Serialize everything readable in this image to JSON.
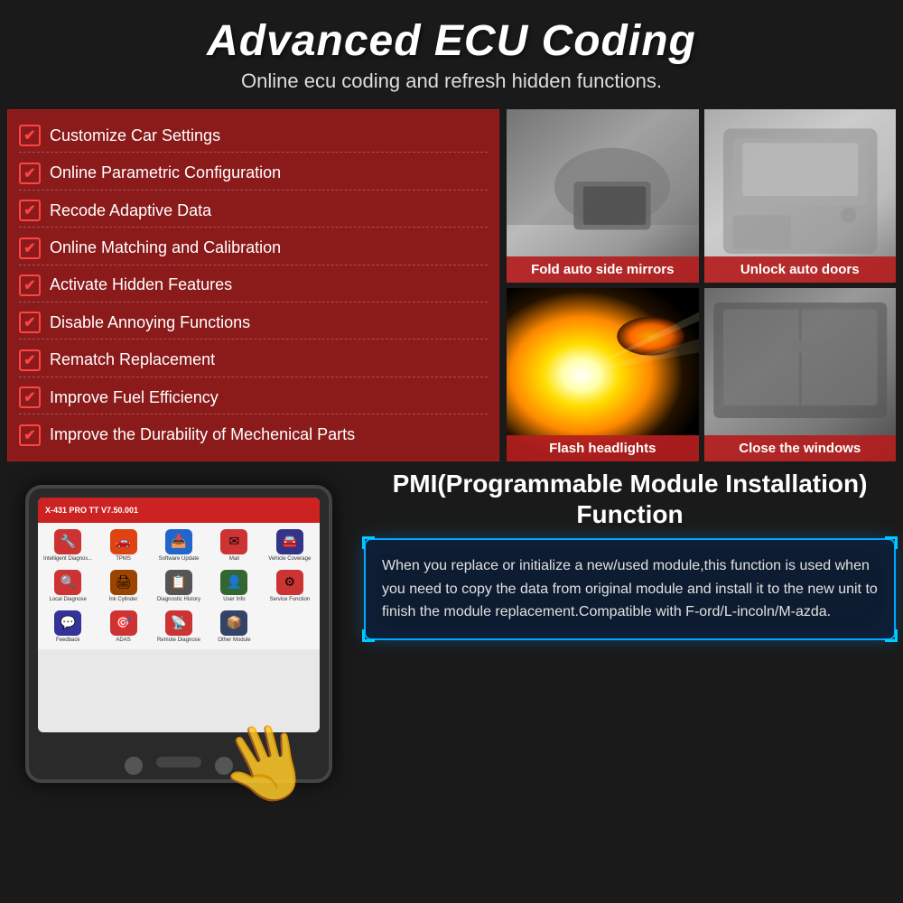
{
  "header": {
    "title": "Advanced ECU Coding",
    "subtitle": "Online ecu coding and refresh hidden functions."
  },
  "features": {
    "items": [
      "Customize Car Settings",
      "Online Parametric Configuration",
      "Recode Adaptive Data",
      "Online Matching and Calibration",
      "Activate Hidden Features",
      "Disable Annoying Functions",
      "Rematch Replacement",
      "Improve Fuel Efficiency",
      "Improve the Durability of Mechenical Parts"
    ]
  },
  "photos": [
    {
      "label": "Fold auto side mirrors",
      "type": "mirror"
    },
    {
      "label": "Unlock auto doors",
      "type": "door"
    },
    {
      "label": "Flash headlights",
      "type": "headlight"
    },
    {
      "label": "Close the windows",
      "type": "window"
    }
  ],
  "pmi": {
    "title": "PMI(Programmable Module Installation) Function",
    "description": "When you replace or initialize a new/used module,this function is used when you need to copy the data from original module and install it to the new unit to finish the module replacement.Compatible with F-ord/L-incoln/M-azda."
  },
  "tablet": {
    "top_bar_text": "X-431 PRO TT V7.50.001",
    "icons": [
      {
        "label": "Intelligent Diagnos...",
        "color": "#cc3333",
        "icon": "🔧"
      },
      {
        "label": "TPMS",
        "color": "#ff6600",
        "icon": "🚗"
      },
      {
        "label": "Software Update",
        "color": "#2266cc",
        "icon": "📥"
      },
      {
        "label": "Mail",
        "color": "#cc3333",
        "icon": "✉"
      },
      {
        "label": "Vehicle Coverage",
        "color": "#333388",
        "icon": "🚘"
      },
      {
        "label": "Local Diagnose",
        "color": "#cc3333",
        "icon": "🔍"
      },
      {
        "label": "Ink Cylinder",
        "color": "#994400",
        "icon": "🖨"
      },
      {
        "label": "Diagnostic History",
        "color": "#555555",
        "icon": "📋"
      },
      {
        "label": "User Info",
        "color": "#336633",
        "icon": "👤"
      },
      {
        "label": "Service Function",
        "color": "#cc3333",
        "icon": "⚙"
      },
      {
        "label": "Feedback",
        "color": "#333399",
        "icon": "💬"
      },
      {
        "label": "ADAS",
        "color": "#cc3333",
        "icon": "🎯"
      },
      {
        "label": "Remote Diagnose",
        "color": "#cc3333",
        "icon": "📡"
      },
      {
        "label": "Other Module",
        "color": "#334466",
        "icon": "📦"
      }
    ]
  }
}
